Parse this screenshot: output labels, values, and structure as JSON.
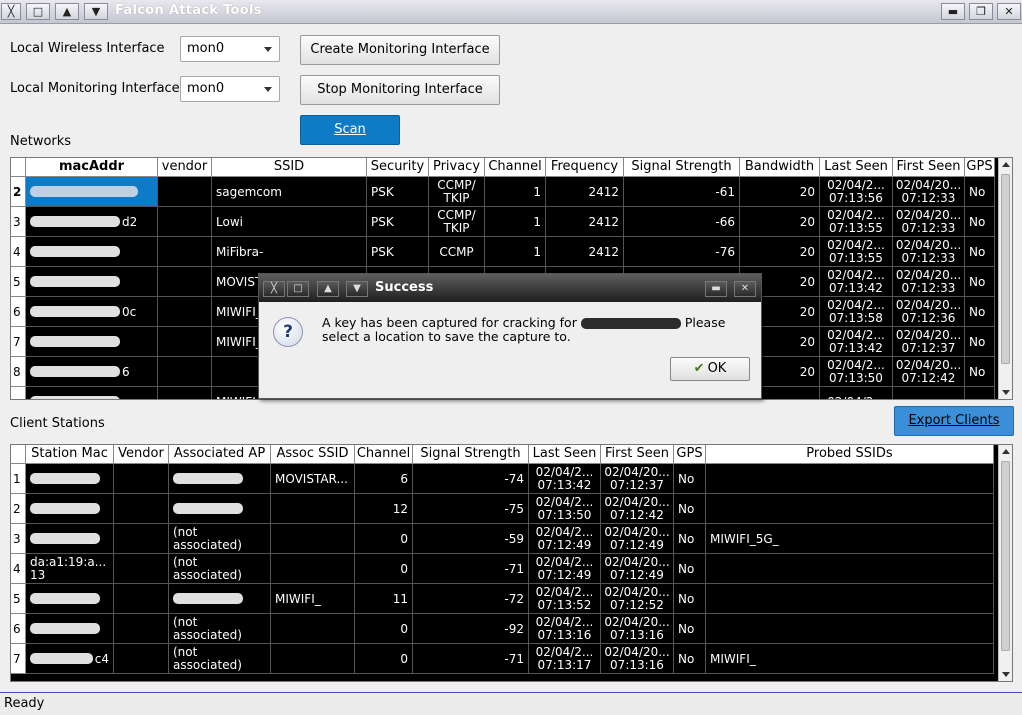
{
  "window": {
    "title": "Falcon Attack Tools",
    "controls": [
      "X",
      "□",
      "▲",
      "▼"
    ],
    "right_controls": [
      "▬",
      "❐",
      "✕"
    ]
  },
  "form": {
    "wireless_label": "Local Wireless Interface",
    "wireless_value": "mon0",
    "monitoring_label": "Local Monitoring Interface",
    "monitoring_value": "mon0",
    "create_button": "Create Monitoring Interface",
    "stop_button": "Stop Monitoring Interface",
    "scan_button": "Scan"
  },
  "networks": {
    "label": "Networks",
    "columns": [
      "macAddr",
      "vendor",
      "SSID",
      "Security",
      "Privacy",
      "Channel",
      "Frequency",
      "Signal Strength",
      "Bandwidth",
      "Last Seen",
      "First Seen",
      "GPS"
    ],
    "rows": [
      {
        "num": "2",
        "mac": "",
        "vendor": "",
        "ssid": "sagemcom",
        "security": "PSK",
        "privacy": "CCMP/\nTKIP",
        "channel": "1",
        "frequency": "2412",
        "signal": "-61",
        "bandwidth": "20",
        "last_seen": "02/04/2...\n07:13:56",
        "first_seen": "02/04/20...\n07:12:33",
        "gps": "No"
      },
      {
        "num": "3",
        "mac": "d2",
        "vendor": "",
        "ssid": "Lowi",
        "security": "PSK",
        "privacy": "CCMP/\nTKIP",
        "channel": "1",
        "frequency": "2412",
        "signal": "-66",
        "bandwidth": "20",
        "last_seen": "02/04/2...\n07:13:55",
        "first_seen": "02/04/20...\n07:12:33",
        "gps": "No"
      },
      {
        "num": "4",
        "mac": "",
        "vendor": "",
        "ssid": "MiFibra-",
        "security": "PSK",
        "privacy": "CCMP",
        "channel": "1",
        "frequency": "2412",
        "signal": "-76",
        "bandwidth": "20",
        "last_seen": "02/04/2...\n07:13:55",
        "first_seen": "02/04/20...\n07:12:33",
        "gps": "No"
      },
      {
        "num": "5",
        "mac": "",
        "vendor": "",
        "ssid": "MOVIST",
        "security": "",
        "privacy": "",
        "channel": "",
        "frequency": "",
        "signal": "",
        "bandwidth": "20",
        "last_seen": "02/04/2...\n07:13:42",
        "first_seen": "02/04/20...\n07:12:33",
        "gps": "No"
      },
      {
        "num": "6",
        "mac": "0c",
        "vendor": "",
        "ssid": "MIWIFI_",
        "security": "",
        "privacy": "",
        "channel": "",
        "frequency": "",
        "signal": "",
        "bandwidth": "20",
        "last_seen": "02/04/2...\n07:13:58",
        "first_seen": "02/04/20...\n07:12:36",
        "gps": "No"
      },
      {
        "num": "7",
        "mac": "",
        "vendor": "",
        "ssid": "MIWIFI_",
        "security": "",
        "privacy": "",
        "channel": "",
        "frequency": "",
        "signal": "",
        "bandwidth": "20",
        "last_seen": "02/04/2...\n07:13:42",
        "first_seen": "02/04/20...\n07:12:37",
        "gps": "No"
      },
      {
        "num": "8",
        "mac": "6",
        "vendor": "",
        "ssid": "",
        "security": "",
        "privacy": "",
        "channel": "",
        "frequency": "",
        "signal": "",
        "bandwidth": "20",
        "last_seen": "02/04/2...\n07:13:50",
        "first_seen": "02/04/20...\n07:12:42",
        "gps": "No"
      },
      {
        "num": "",
        "mac": "",
        "vendor": "",
        "ssid": "MIWIFI_",
        "security": "",
        "privacy": "",
        "channel": "",
        "frequency": "",
        "signal": "",
        "bandwidth": "",
        "last_seen": "02/04/2...",
        "first_seen": "",
        "gps": ""
      }
    ]
  },
  "clients": {
    "label": "Client Stations",
    "export_button": "Export Clients",
    "columns": [
      "Station Mac",
      "Vendor",
      "Associated AP",
      "Assoc SSID",
      "Channel",
      "Signal Strength",
      "Last Seen",
      "First Seen",
      "GPS",
      "Probed SSIDs"
    ],
    "rows": [
      {
        "num": "1",
        "mac": "",
        "vendor": "",
        "ap": "",
        "ssid": "MOVISTAR...",
        "channel": "6",
        "signal": "-74",
        "last_seen": "02/04/2...\n07:13:42",
        "first_seen": "02/04/20...\n07:12:37",
        "gps": "No",
        "probed": ""
      },
      {
        "num": "2",
        "mac": "",
        "vendor": "",
        "ap": "",
        "ssid": "",
        "channel": "12",
        "signal": "-75",
        "last_seen": "02/04/2...\n07:13:50",
        "first_seen": "02/04/20...\n07:12:42",
        "gps": "No",
        "probed": ""
      },
      {
        "num": "3",
        "mac": "",
        "vendor": "",
        "ap": "(not\nassociated)",
        "ssid": "",
        "channel": "0",
        "signal": "-59",
        "last_seen": "02/04/2...\n07:12:49",
        "first_seen": "02/04/20...\n07:12:49",
        "gps": "No",
        "probed": "MIWIFI_5G_"
      },
      {
        "num": "4",
        "mac": "da:a1:19:a...\n13",
        "vendor": "",
        "ap": "(not\nassociated)",
        "ssid": "",
        "channel": "0",
        "signal": "-71",
        "last_seen": "02/04/2...\n07:12:49",
        "first_seen": "02/04/20...\n07:12:49",
        "gps": "No",
        "probed": ""
      },
      {
        "num": "5",
        "mac": "",
        "vendor": "",
        "ap": "",
        "ssid": "MIWIFI_",
        "channel": "11",
        "signal": "-72",
        "last_seen": "02/04/2...\n07:13:52",
        "first_seen": "02/04/20...\n07:12:52",
        "gps": "No",
        "probed": ""
      },
      {
        "num": "6",
        "mac": "",
        "vendor": "",
        "ap": "(not\nassociated)",
        "ssid": "",
        "channel": "0",
        "signal": "-92",
        "last_seen": "02/04/2...\n07:13:16",
        "first_seen": "02/04/20...\n07:13:16",
        "gps": "No",
        "probed": ""
      },
      {
        "num": "7",
        "mac": "c4",
        "vendor": "",
        "ap": "(not\nassociated)",
        "ssid": "",
        "channel": "0",
        "signal": "-71",
        "last_seen": "02/04/2...\n07:13:17",
        "first_seen": "02/04/20...\n07:13:16",
        "gps": "No",
        "probed": "MIWIFI_"
      }
    ]
  },
  "dialog": {
    "title": "Success",
    "message_line1_a": "A key has been captured for cracking for",
    "message_line1_b": "Please",
    "message_line2": "select a location to save the capture to.",
    "ok": "OK",
    "icon": "question-icon"
  },
  "status": {
    "text": "Ready"
  }
}
